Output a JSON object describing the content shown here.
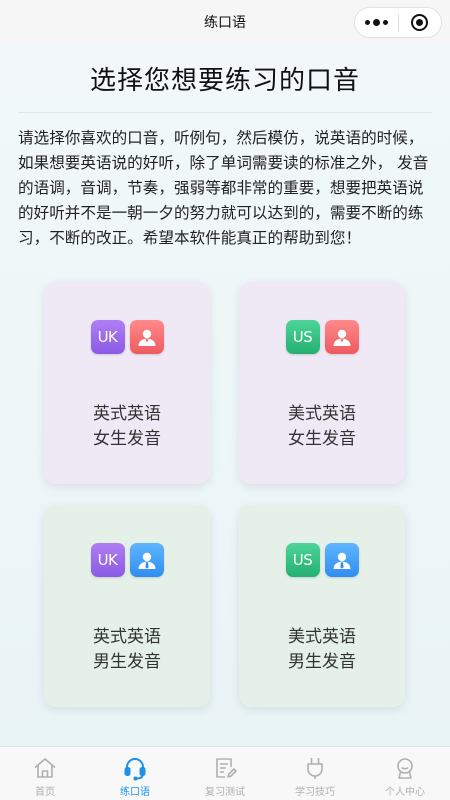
{
  "navbar": {
    "title": "练口语",
    "more_icon": "more-dots-icon",
    "close_icon": "target-close-icon"
  },
  "page": {
    "title": "选择您想要练习的口音",
    "intro": "请选择你喜欢的口音，听例句，然后模仿，说英语的时候，如果想要英语说的好听，除了单词需要读的标准之外， 发音的语调，音调，节奏，强弱等都非常的重要，想要把英语说的好听并不是一朝一夕的努力就可以达到的，需要不断的练习，不断的改正。希望本软件能真正的帮助到您！"
  },
  "cards": [
    {
      "region_badge": "UK",
      "line1": "英式英语",
      "line2": "女生发音",
      "gender": "female"
    },
    {
      "region_badge": "US",
      "line1": "美式英语",
      "line2": "女生发音",
      "gender": "female"
    },
    {
      "region_badge": "UK",
      "line1": "英式英语",
      "line2": "男生发音",
      "gender": "male"
    },
    {
      "region_badge": "US",
      "line1": "美式英语",
      "line2": "男生发音",
      "gender": "male"
    }
  ],
  "tabbar": {
    "items": [
      {
        "label": "首页",
        "icon": "home-icon",
        "active": false
      },
      {
        "label": "练口语",
        "icon": "headset-icon",
        "active": true
      },
      {
        "label": "复习测试",
        "icon": "edit-note-icon",
        "active": false
      },
      {
        "label": "学习技巧",
        "icon": "plug-icon",
        "active": false
      },
      {
        "label": "个人中心",
        "icon": "profile-icon",
        "active": false
      }
    ]
  },
  "colors": {
    "accent": "#1e90e8",
    "uk_badge": "#9a6aec",
    "us_badge": "#2fbf7e",
    "female_avatar": "#f06a6c",
    "male_avatar": "#3a96f2",
    "female_card_bg": "#efe9f6",
    "male_card_bg": "#e5f1e8",
    "inactive_tab": "#b0b0b0"
  }
}
